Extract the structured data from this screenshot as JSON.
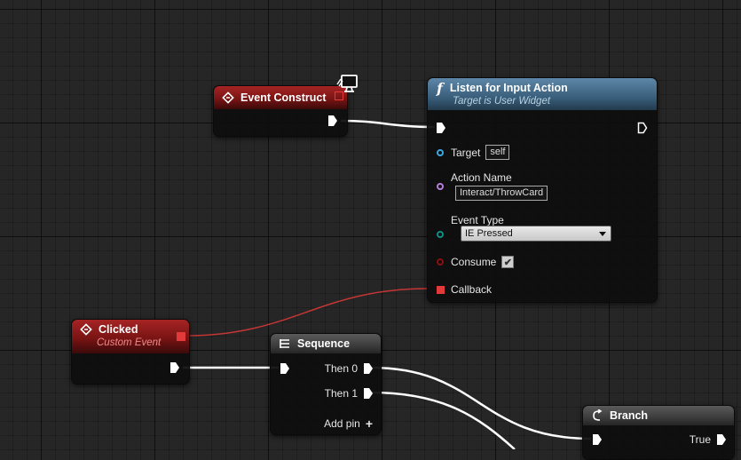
{
  "nodes": {
    "event_construct": {
      "title": "Event Construct"
    },
    "listen": {
      "title": "Listen for Input Action",
      "subtitle": "Target is User Widget",
      "target_label": "Target",
      "target_value": "self",
      "action_name_label": "Action Name",
      "action_name_value": "Interact/ThrowCard",
      "event_type_label": "Event Type",
      "event_type_value": "IE Pressed",
      "consume_label": "Consume",
      "callback_label": "Callback"
    },
    "clicked": {
      "title": "Clicked",
      "subtitle": "Custom Event"
    },
    "sequence": {
      "title": "Sequence",
      "then0": "Then 0",
      "then1": "Then 1",
      "add_pin": "Add pin"
    },
    "branch": {
      "title": "Branch",
      "true_label": "True"
    }
  },
  "colors": {
    "exec_wire": "#ffffff",
    "delegate_wire": "#c43636",
    "object_pin": "#3aa7e0",
    "name_pin": "#b77ddb",
    "enum_pin": "#0f8f84",
    "bool_pin": "#8a0f0f"
  }
}
